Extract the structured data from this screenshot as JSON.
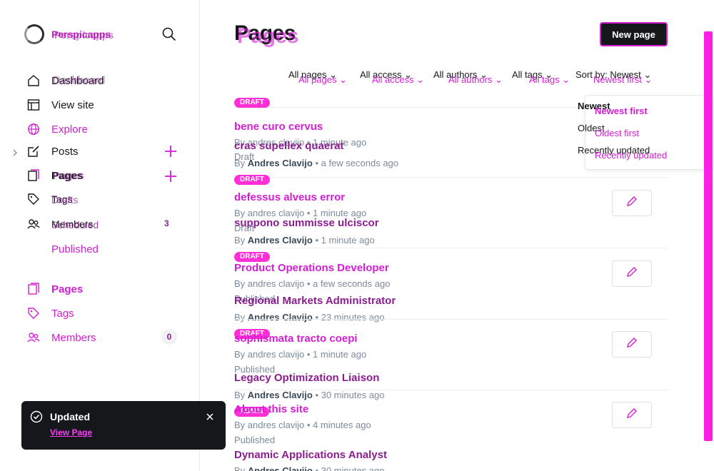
{
  "sidebar": {
    "brand": "Perspicapps",
    "nav": {
      "dashboard": "Dashboard",
      "view_site": "View site",
      "explore": "Explore",
      "posts": "Posts",
      "pages": "Pages",
      "tags": "Tags",
      "members": "Members",
      "members_count": "3"
    },
    "posts_sub": {
      "drafts": "Drafts",
      "scheduled": "Scheduled",
      "published": "Published"
    },
    "lower_nav": {
      "pages": "Pages",
      "tags": "Tags",
      "members": "Members",
      "members_count": "0"
    }
  },
  "toast": {
    "title": "Updated",
    "link": "View Page"
  },
  "header": {
    "title": "Pages",
    "new_button": "New page"
  },
  "filters": {
    "pages": "All pages",
    "access": "All access",
    "authors": "All authors",
    "tags": "All tags",
    "sort": "Sort by: Newest",
    "sort_ghost": "Newest first"
  },
  "sort_menu": {
    "newest": "Newest",
    "newest_first": "Newest first",
    "oldest": "Oldest",
    "oldest_first": "Oldest first",
    "recently_updated": "Recently updated",
    "recently_updated_ghost": "Recently updated"
  },
  "rows": [
    {
      "badge": "DRAFT",
      "title": "bene curo cervus",
      "meta": "By andres clavijo • 1 minute ago",
      "status": "Draft",
      "title2": "cras supellex quaerat",
      "meta2_author": "Andres Clavijo",
      "meta2_time": " • a few seconds ago"
    },
    {
      "badge": "DRAFT",
      "title": "defessus alveus error",
      "meta": "By andres clavijo • 1 minute ago",
      "status": "Draft",
      "title2": "suppono summisse ulciscor",
      "meta2_author": "Andres Clavijo",
      "meta2_time": " • 1 minute ago"
    },
    {
      "badge": "DRAFT",
      "title": "Product Operations Developer",
      "meta": "By andres clavijo • a few seconds ago",
      "status": "Published",
      "title2": "Regional Markets Administrator",
      "meta2_author": "Andres Clavijo",
      "meta2_time": " • 23 minutes ago"
    },
    {
      "badge": "DRAFT",
      "title": "sophismata tracto coepi",
      "meta": "By andres clavijo • 1 minute ago",
      "status": "Published",
      "title2": "Legacy Optimization Liaison",
      "meta2_author": "Andres Clavijo",
      "meta2_time": " • 30 minutes ago"
    },
    {
      "badge": "ADMIN",
      "title": "About this site",
      "meta": "By andres clavijo • 4 minutes ago",
      "status": "Published",
      "title2": "Dynamic Applications Analyst",
      "meta2_author": "Andres Clavijo",
      "meta2_time": " • 30 minutes ago"
    }
  ],
  "colors": {
    "accent": "#d21ed2",
    "badge": "#ff2ed6",
    "toast_bg": "#15171a",
    "scrollbar": "#ff1ee8"
  }
}
